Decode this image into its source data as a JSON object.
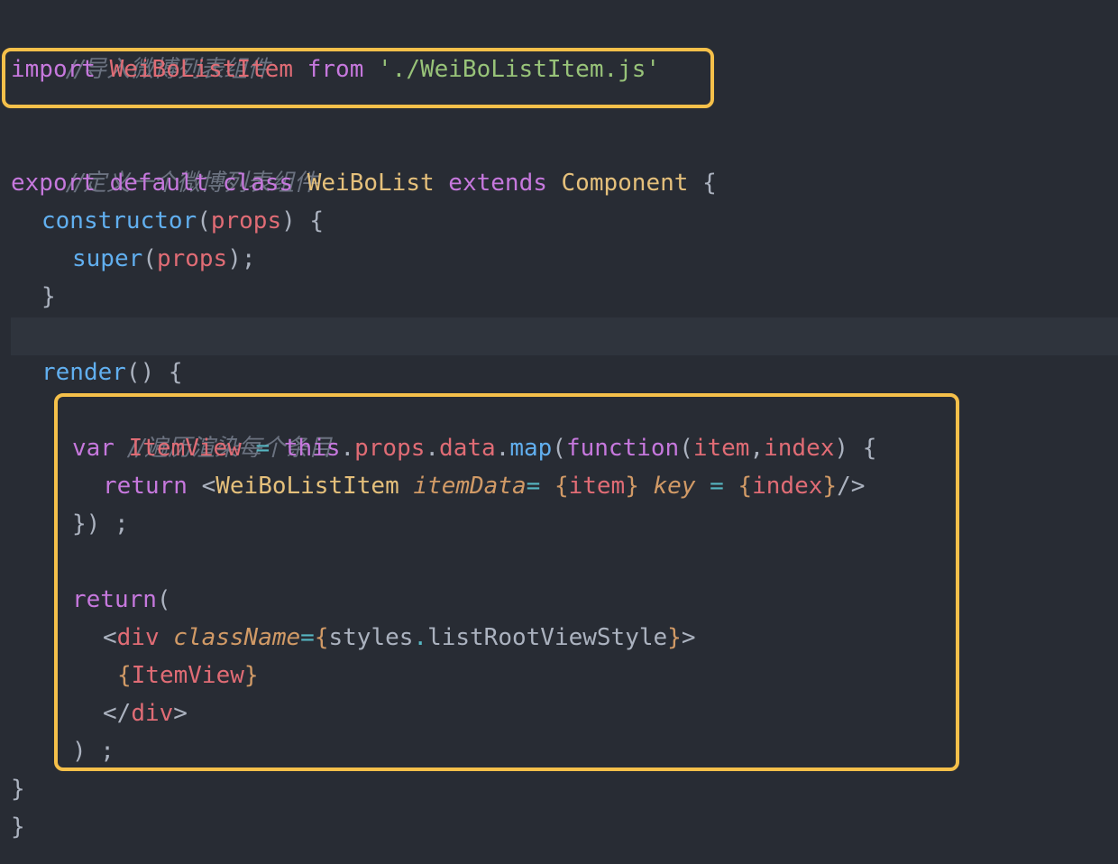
{
  "colors": {
    "background": "#282c34",
    "highlight_box": "#f5c04a",
    "comment": "#6b7280",
    "keyword": "#c678dd",
    "identifier": "#e06c75",
    "string": "#98c379",
    "class": "#e5c07b",
    "function": "#61afef",
    "operator": "#56b6c2",
    "attribute": "#d19a66"
  },
  "code": {
    "line1_comment": "//导入微博列表组件",
    "line2": {
      "kw_import": "import",
      "ident": "WeiBoListItem",
      "kw_from": "from",
      "string": "'./WeiBoListItem.js'"
    },
    "line3_comment": "//定义一个微博列表组件",
    "line4": {
      "kw_export": "export",
      "kw_default": "default",
      "kw_class": "class",
      "class_name": "WeiBoList",
      "kw_extends": "extends",
      "parent": "Component",
      "brace": "{"
    },
    "line5": {
      "fn": "constructor",
      "open": "(",
      "param": "props",
      "close": ") {"
    },
    "line6": {
      "fn": "super",
      "open": "(",
      "param": "props",
      "close": ");"
    },
    "line7": "}",
    "line9": {
      "fn": "render",
      "rest": "() {"
    },
    "line10_comment": "//遍历渲染每个条目",
    "line11": {
      "kw_var": "var",
      "ident": "ItemView",
      "eq": "=",
      "kw_this": "this",
      "dot1": ".",
      "prop1": "props",
      "dot2": ".",
      "prop2": "data",
      "dot3": ".",
      "fn_map": "map",
      "open": "(",
      "kw_function": "function",
      "open2": "(",
      "p1": "item",
      "comma": ",",
      "p2": "index",
      "close": ") {"
    },
    "line12": {
      "kw_return": "return",
      "lt": "<",
      "comp": "WeiBoListItem",
      "attr1": "itemData",
      "eq1": "=",
      "b1o": "{",
      "v1": "item",
      "b1c": "}",
      "attr2": "key",
      "eq2": "=",
      "b2o": "{",
      "v2": "index",
      "b2c": "}",
      "end": "/>"
    },
    "line13": "}) ;",
    "line15": {
      "kw_return": "return",
      "open": "("
    },
    "line16": {
      "lt": "<",
      "tag": "div",
      "attr": "className",
      "eq": "=",
      "bo": "{",
      "obj": "styles",
      "dot": ".",
      "prop": "listRootViewStyle",
      "bc": "}",
      "gt": ">"
    },
    "line17": {
      "bo": "{",
      "v": "ItemView",
      "bc": "}"
    },
    "line18": {
      "lt": "</",
      "tag": "div",
      "gt": ">"
    },
    "line19": ") ;",
    "line20": "}",
    "line21": "}"
  }
}
